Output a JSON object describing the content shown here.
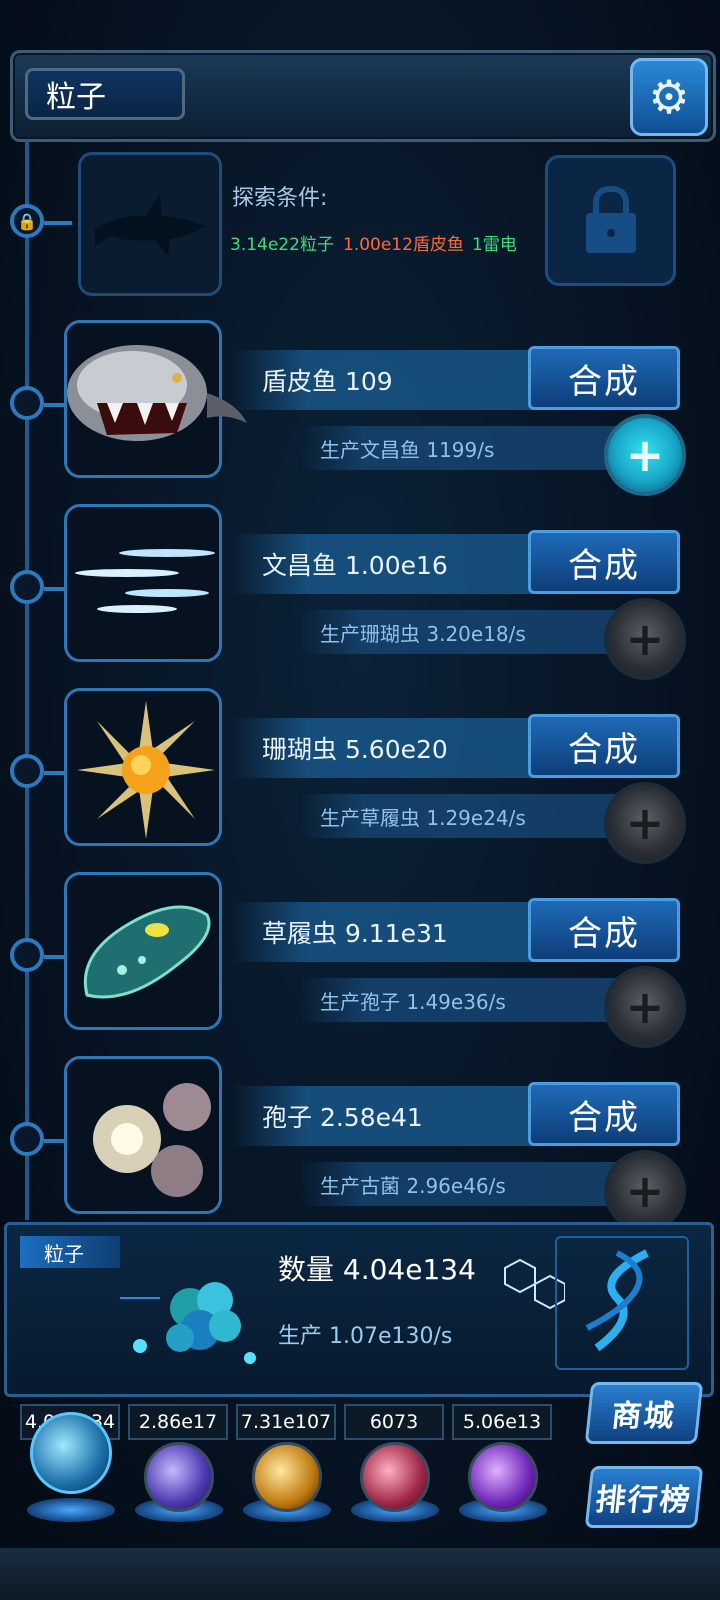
{
  "header": {
    "title": "粒子",
    "settings_icon": "gear-icon"
  },
  "locked_creature": {
    "explore_label": "探索条件:",
    "conditions": [
      {
        "text": "3.14e22粒子",
        "color": "#3fdc7a"
      },
      {
        "text": "1.00e12盾皮鱼",
        "color": "#ff6a3a"
      },
      {
        "text": "1雷电",
        "color": "#3fdc7a"
      }
    ]
  },
  "creatures": [
    {
      "name": "盾皮鱼 109",
      "produce": "生产文昌鱼 1199/s",
      "action": "合成",
      "plus_active": true,
      "icon": "dunkleosteus-fish-icon"
    },
    {
      "name": "文昌鱼 1.00e16",
      "produce": "生产珊瑚虫 3.20e18/s",
      "action": "合成",
      "plus_active": false,
      "icon": "lancelet-fish-icon"
    },
    {
      "name": "珊瑚虫 5.60e20",
      "produce": "生产草履虫 1.29e24/s",
      "action": "合成",
      "plus_active": false,
      "icon": "coral-polyp-icon"
    },
    {
      "name": "草履虫 9.11e31",
      "produce": "生产孢子 1.49e36/s",
      "action": "合成",
      "plus_active": false,
      "icon": "paramecium-icon"
    },
    {
      "name": "孢子 2.58e41",
      "produce": "生产古菌 2.96e46/s",
      "action": "合成",
      "plus_active": false,
      "icon": "spore-icon"
    }
  ],
  "particle_panel": {
    "tag": "粒子",
    "count": "数量 4.04e134",
    "produce": "生产 1.07e130/s"
  },
  "resources": [
    {
      "value": "4.04e134",
      "icon": "particle-orb-icon",
      "color": "#3ab0e8"
    },
    {
      "value": "2.86e17",
      "icon": "lightning-orb-icon",
      "color": "#7a5ce8"
    },
    {
      "value": "7.31e107",
      "icon": "nebula-orb-icon",
      "color": "#e8a23a"
    },
    {
      "value": "6073",
      "icon": "brain-orb-icon",
      "color": "#d8507a"
    },
    {
      "value": "5.06e13",
      "icon": "vortex-orb-icon",
      "color": "#b05ae8"
    }
  ],
  "side_buttons": {
    "shop": "商城",
    "ranking": "排行榜"
  }
}
